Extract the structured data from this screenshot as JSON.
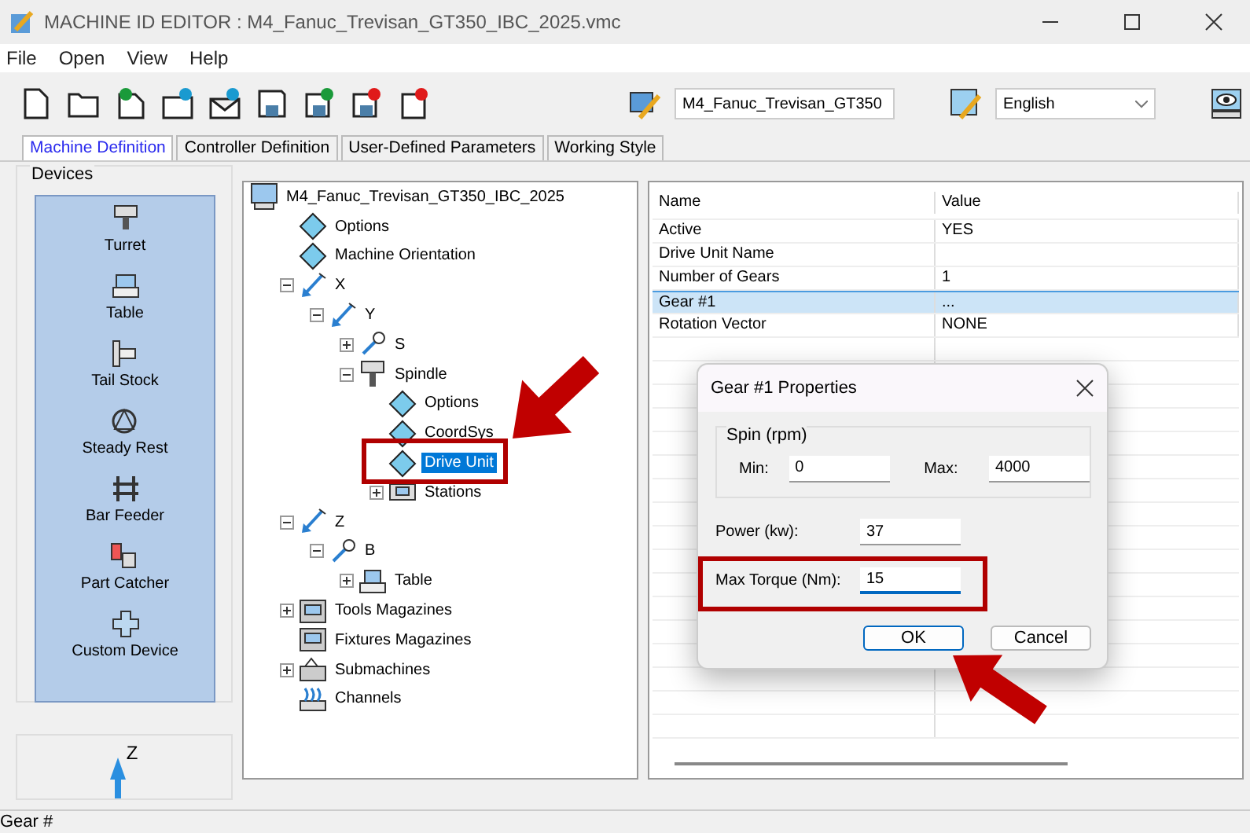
{
  "window": {
    "title": "MACHINE ID EDITOR : M4_Fanuc_Trevisan_GT350_IBC_2025.vmc"
  },
  "menu": [
    "File",
    "Open",
    "View",
    "Help"
  ],
  "toolbar": {
    "machine_select": "M4_Fanuc_Trevisan_GT350",
    "language_select": "English"
  },
  "tabs": [
    {
      "label": "Machine Definition",
      "selected": true
    },
    {
      "label": "Controller Definition",
      "selected": false
    },
    {
      "label": "User-Defined Parameters",
      "selected": false
    },
    {
      "label": "Working Style",
      "selected": false
    }
  ],
  "devices": {
    "title": "Devices",
    "items": [
      {
        "label": "Turret",
        "kind": "turret"
      },
      {
        "label": "Table",
        "kind": "table"
      },
      {
        "label": "Tail Stock",
        "kind": "tailstock"
      },
      {
        "label": "Steady Rest",
        "kind": "steadyrest"
      },
      {
        "label": "Bar Feeder",
        "kind": "barfeeder"
      },
      {
        "label": "Part Catcher",
        "kind": "partcatcher"
      },
      {
        "label": "Custom Device",
        "kind": "custom"
      }
    ]
  },
  "axis_view": {
    "label": "Z"
  },
  "tree": [
    {
      "label": "M4_Fanuc_Trevisan_GT350_IBC_2025",
      "kind": "machine",
      "selected": false,
      "children": [
        {
          "label": "Options",
          "kind": "diamond",
          "selected": false
        },
        {
          "label": "Machine Orientation",
          "kind": "diamond",
          "selected": false
        },
        {
          "label": "X",
          "kind": "axis",
          "selected": false,
          "expanded": true,
          "children": [
            {
              "label": "Y",
              "kind": "axis",
              "selected": false,
              "expanded": true,
              "children": [
                {
                  "label": "S",
                  "kind": "rotary",
                  "selected": false,
                  "expanded": false
                },
                {
                  "label": "Spindle",
                  "kind": "spindle",
                  "selected": false,
                  "expanded": true,
                  "children": [
                    {
                      "label": "Options",
                      "kind": "diamond",
                      "selected": false
                    },
                    {
                      "label": "CoordSys",
                      "kind": "diamond",
                      "selected": false
                    },
                    {
                      "label": "Drive Unit",
                      "kind": "diamond",
                      "selected": true
                    },
                    {
                      "label": "Stations",
                      "kind": "stations",
                      "selected": false,
                      "expanded": false
                    }
                  ]
                }
              ]
            }
          ]
        },
        {
          "label": "Z",
          "kind": "axis",
          "selected": false,
          "expanded": true,
          "children": [
            {
              "label": "B",
              "kind": "rotary",
              "selected": false,
              "expanded": true,
              "children": [
                {
                  "label": "Table",
                  "kind": "table",
                  "selected": false,
                  "expanded": false
                }
              ]
            }
          ]
        },
        {
          "label": "Tools Magazines",
          "kind": "magazine",
          "selected": false,
          "expanded": false
        },
        {
          "label": "Fixtures Magazines",
          "kind": "magazine",
          "selected": false
        },
        {
          "label": "Submachines",
          "kind": "submachine",
          "selected": false,
          "expanded": false
        },
        {
          "label": "Channels",
          "kind": "channels",
          "selected": false
        }
      ]
    }
  ],
  "properties": {
    "columns": [
      "Name",
      "Value"
    ],
    "rows": [
      {
        "name": "Active",
        "value": "YES",
        "selected": false
      },
      {
        "name": "Drive Unit Name",
        "value": "",
        "selected": false
      },
      {
        "name": "Number of Gears",
        "value": "1",
        "selected": false
      },
      {
        "name": "Gear #1",
        "value": "...",
        "selected": true
      },
      {
        "name": "Rotation Vector",
        "value": "NONE",
        "selected": false
      }
    ]
  },
  "dialog": {
    "title": "Gear #1 Properties",
    "spin_group": {
      "label": "Spin (rpm)",
      "fields": [
        {
          "label": "Min:",
          "value": "0",
          "focused": false
        },
        {
          "label": "Max:",
          "value": "4000",
          "focused": false
        }
      ]
    },
    "fields": [
      {
        "label": "Power (kw):",
        "value": "37",
        "focused": false
      },
      {
        "label": "Max Torque (Nm):",
        "value": "15",
        "focused": true
      }
    ],
    "buttons": [
      {
        "label": "OK",
        "default": true
      },
      {
        "label": "Cancel",
        "default": false
      }
    ]
  },
  "status_bar": "Gear #"
}
